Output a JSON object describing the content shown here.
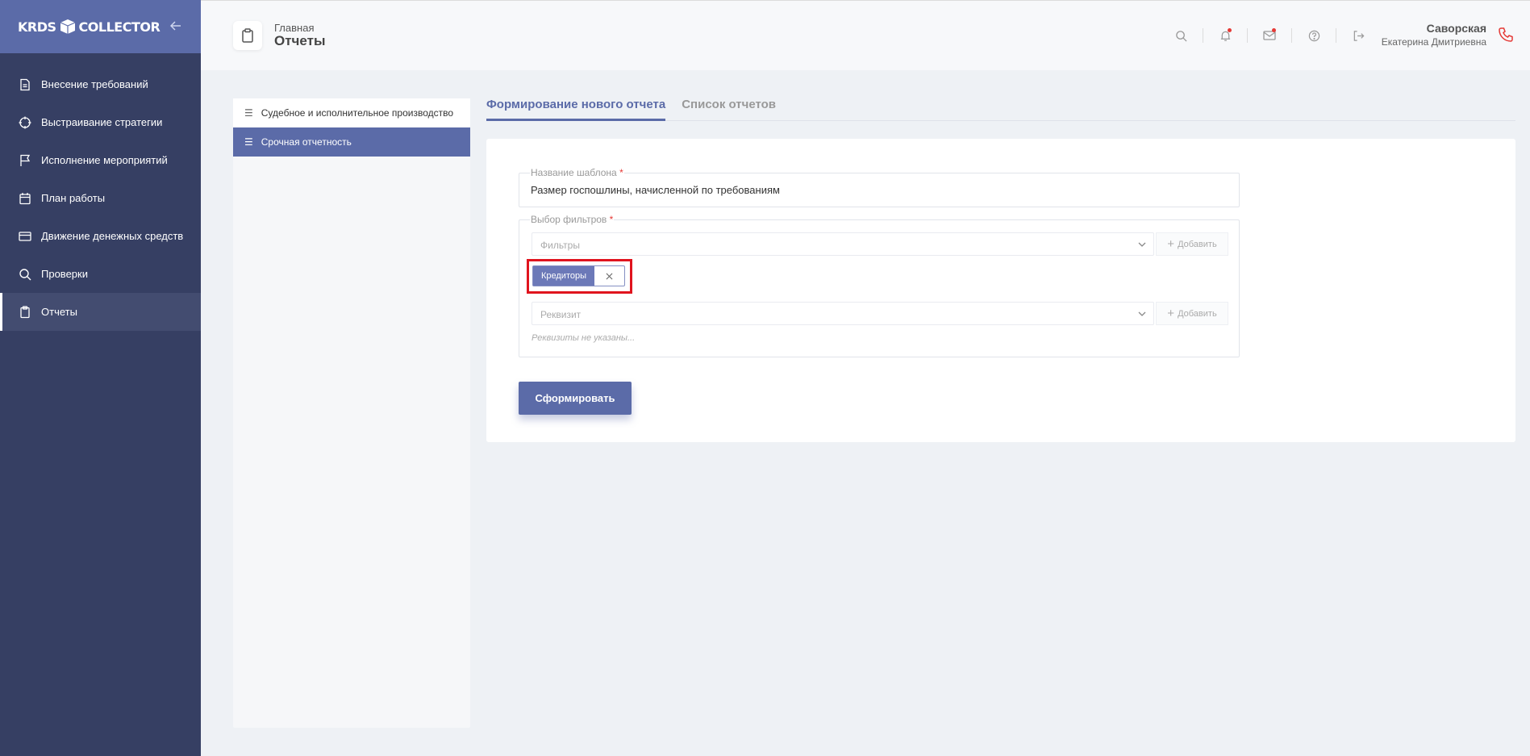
{
  "app": {
    "logo_left": "KRDS",
    "logo_right": "COLLECTOR"
  },
  "sidebar": {
    "items": [
      {
        "label": "Внесение требований",
        "icon": "document-icon"
      },
      {
        "label": "Выстраивание стратегии",
        "icon": "crosshair-icon"
      },
      {
        "label": "Исполнение мероприятий",
        "icon": "flag-icon"
      },
      {
        "label": "План работы",
        "icon": "calendar-icon"
      },
      {
        "label": "Движение денежных средств",
        "icon": "credit-card-icon"
      },
      {
        "label": "Проверки",
        "icon": "search-icon"
      },
      {
        "label": "Отчеты",
        "icon": "clipboard-icon",
        "active": true
      }
    ]
  },
  "header": {
    "breadcrumb": "Главная",
    "title": "Отчеты",
    "user_name": "Саворская",
    "user_sub": "Екатерина Дмитриевна"
  },
  "subnav": {
    "items": [
      {
        "label": "Судебное и исполнительное производство"
      },
      {
        "label": "Срочная отчетность",
        "active": true
      }
    ]
  },
  "tabs": [
    {
      "label": "Формирование нового отчета",
      "active": true
    },
    {
      "label": "Список отчетов"
    }
  ],
  "form": {
    "template_label": "Название шаблона",
    "template_value": "Размер госпошлины, начисленной по требованиям",
    "filters_label": "Выбор фильтров",
    "required_mark": "*",
    "filters_placeholder": "Фильтры",
    "add_label": "Добавить",
    "chip_label": "Кредиторы",
    "requisite_placeholder": "Реквизит",
    "requisites_empty": "Реквизиты не указаны...",
    "submit_label": "Сформировать"
  },
  "colors": {
    "accent": "#5b6ba8",
    "sidebar": "#363f63",
    "highlight": "#e0141e"
  }
}
